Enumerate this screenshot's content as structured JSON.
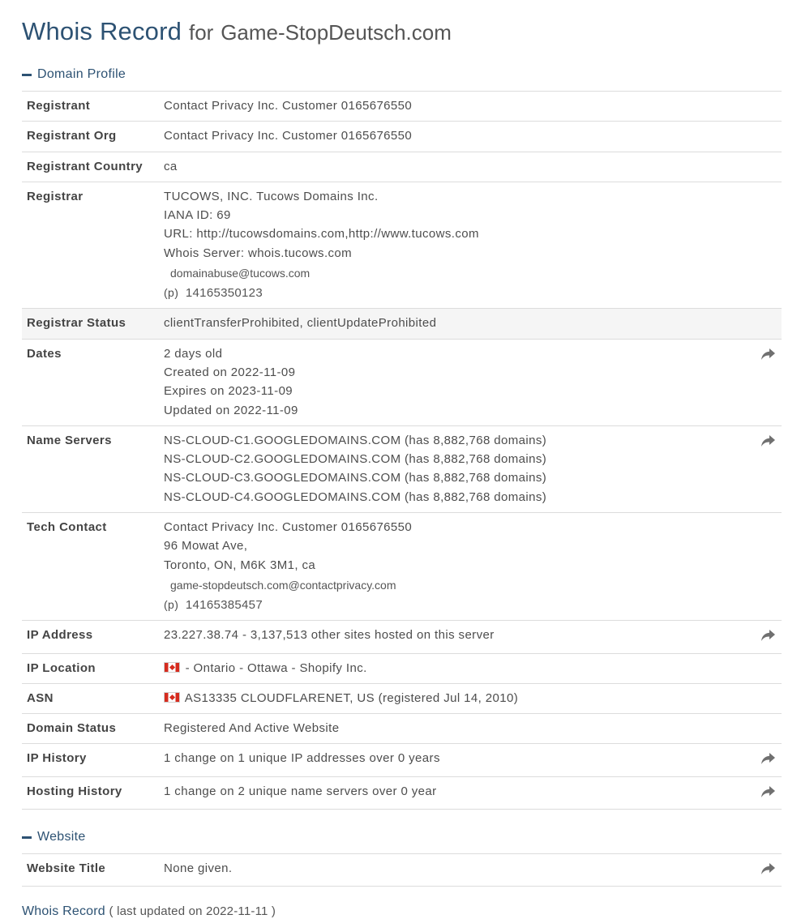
{
  "title": {
    "main": "Whois Record",
    "for": "for",
    "domain": "Game-StopDeutsch.com"
  },
  "sections": {
    "domain_profile": "Domain Profile",
    "website": "Website"
  },
  "profile": {
    "registrant": {
      "label": "Registrant",
      "value": "Contact Privacy Inc. Customer 0165676550"
    },
    "registrant_org": {
      "label": "Registrant Org",
      "value": "Contact Privacy Inc. Customer 0165676550"
    },
    "registrant_country": {
      "label": "Registrant Country",
      "value": "ca"
    },
    "registrar": {
      "label": "Registrar",
      "name": "TUCOWS, INC. Tucows Domains Inc.",
      "iana": "IANA ID: 69",
      "url": "URL: http://tucowsdomains.com,http://www.tucows.com",
      "whois": "Whois Server: whois.tucows.com",
      "email": "domainabuse@tucows.com",
      "phone_label": "(p)",
      "phone": "14165350123"
    },
    "registrar_status": {
      "label": "Registrar Status",
      "value": "clientTransferProhibited, clientUpdateProhibited"
    },
    "dates": {
      "label": "Dates",
      "age": "2 days old",
      "created": "Created on 2022-11-09",
      "expires": "Expires on 2023-11-09",
      "updated": "Updated on 2022-11-09"
    },
    "name_servers": {
      "label": "Name Servers",
      "ns1": "NS-CLOUD-C1.GOOGLEDOMAINS.COM (has 8,882,768 domains)",
      "ns2": "NS-CLOUD-C2.GOOGLEDOMAINS.COM (has 8,882,768 domains)",
      "ns3": "NS-CLOUD-C3.GOOGLEDOMAINS.COM (has 8,882,768 domains)",
      "ns4": "NS-CLOUD-C4.GOOGLEDOMAINS.COM (has 8,882,768 domains)"
    },
    "tech_contact": {
      "label": "Tech Contact",
      "name": "Contact Privacy Inc. Customer 0165676550",
      "street": "96 Mowat Ave,",
      "city": "Toronto, ON, M6K 3M1, ca",
      "email": "game-stopdeutsch.com@contactprivacy.com",
      "phone_label": "(p)",
      "phone": "14165385457"
    },
    "ip_address": {
      "label": "IP Address",
      "value": "23.227.38.74 - 3,137,513 other sites hosted on this server"
    },
    "ip_location": {
      "label": "IP Location",
      "value": " - Ontario - Ottawa - Shopify Inc."
    },
    "asn": {
      "label": "ASN",
      "value": "AS13335 CLOUDFLARENET, US (registered Jul 14, 2010)"
    },
    "domain_status": {
      "label": "Domain Status",
      "value": "Registered And Active Website"
    },
    "ip_history": {
      "label": "IP History",
      "value": "1 change on 1 unique IP addresses over 0 years"
    },
    "hosting_history": {
      "label": "Hosting History",
      "value": "1 change on 2 unique name servers over 0 year"
    }
  },
  "website": {
    "title": {
      "label": "Website Title",
      "value": "None given."
    }
  },
  "footer": {
    "main": "Whois Record",
    "sub": "( last updated on 2022-11-11 )"
  },
  "icons": {
    "share": "share-arrow-icon",
    "flag": "canada-flag-icon",
    "collapse": "minus-icon"
  },
  "colors": {
    "heading": "#2d5273",
    "border": "#dcdcdc",
    "shaded_row": "#f5f5f5"
  }
}
